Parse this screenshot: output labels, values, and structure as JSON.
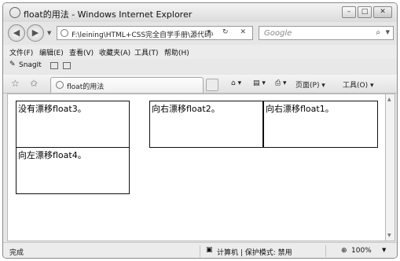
{
  "window": {
    "title": "float的用法 - Windows Internet Explorer",
    "buttons": {
      "minimize": "–",
      "maximize": "□",
      "close": "✕"
    }
  },
  "address": {
    "url": "F:\\leining\\HTML+CSS完全自学手册\\源代码\\第",
    "controls": "▾ ↻ ✕"
  },
  "search": {
    "placeholder": "Google",
    "icon": "⌕"
  },
  "menu": [
    "文件(F)",
    "编辑(E)",
    "查看(V)",
    "收藏夹(A)",
    "工具(T)",
    "帮助(H)"
  ],
  "links": {
    "snagit": "SnagIt"
  },
  "tab": {
    "label": "float的用法"
  },
  "commands": {
    "home": "⌂ ▾",
    "feeds": "▤ ▾",
    "print": "⎙ ▾",
    "page": "页面(P) ▾",
    "tools": "工具(O) ▾"
  },
  "page": {
    "box3": "没有漂移float3。",
    "box2": "向右漂移float2。",
    "box1": "向右漂移float1。",
    "box4": "向左漂移float4。"
  },
  "status": {
    "done": "完成",
    "zone": "计算机 | 保护模式: 禁用",
    "zoom": "100%"
  }
}
